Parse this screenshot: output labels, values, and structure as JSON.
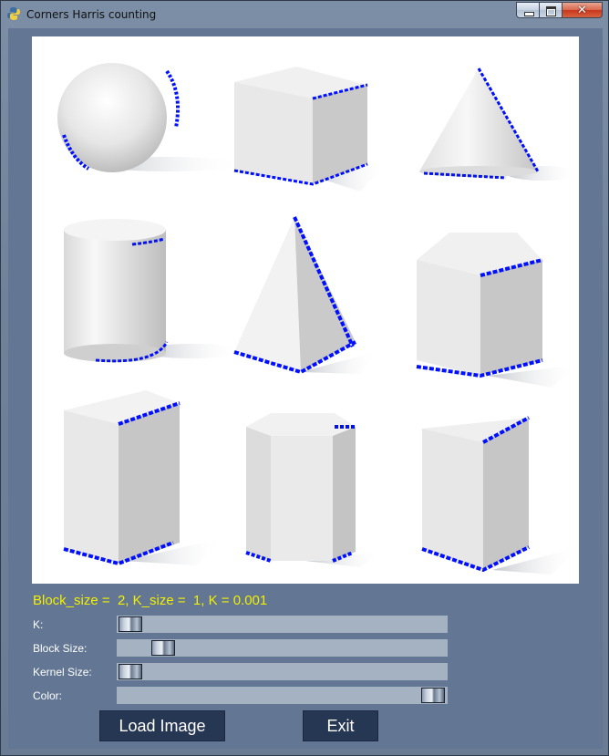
{
  "window": {
    "title": "Corners Harris counting"
  },
  "status_text": "Block_size =  2, K_size =  1, K = 0.001",
  "sliders": {
    "k": {
      "label": "K:",
      "position": 0.0
    },
    "block": {
      "label": "Block Size:",
      "position": 0.12
    },
    "kernel": {
      "label": "Kernel Size:",
      "position": 0.0
    },
    "color": {
      "label": "Color:",
      "position": 1.0
    }
  },
  "buttons": {
    "load": "Load Image",
    "exit": "Exit"
  },
  "image": {
    "shapes": [
      "sphere",
      "cube",
      "cone",
      "cylinder",
      "pyramid",
      "pentagonal-prism",
      "box",
      "hexagonal-prism",
      "triangular-prism"
    ],
    "corner_marker_color": "#0010ff"
  },
  "colors": {
    "client_bg": "#637693",
    "status_text": "#f2f000",
    "track": "#a5b2c2",
    "button_bg": "#253753"
  }
}
